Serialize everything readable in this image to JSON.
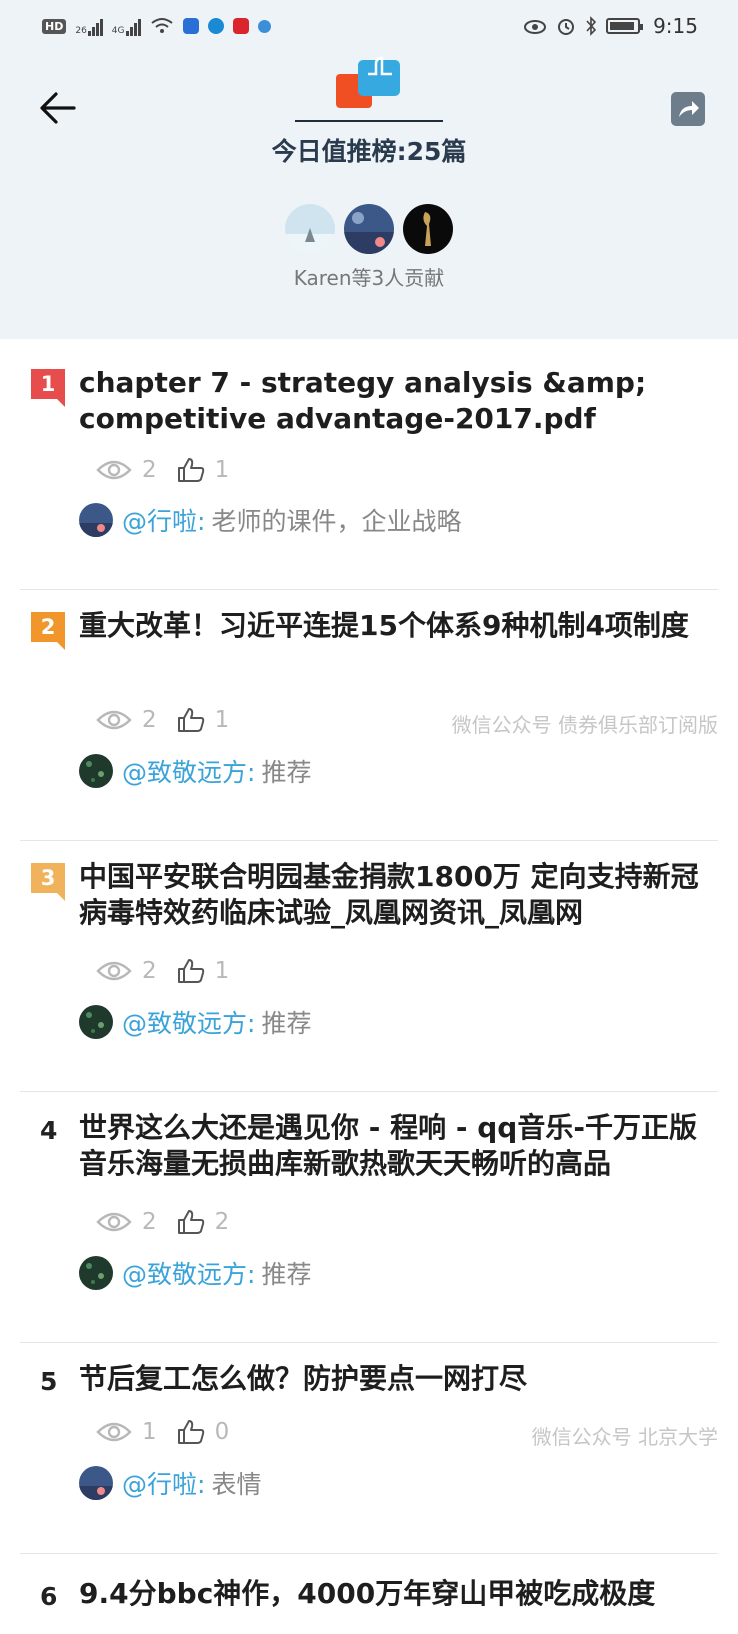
{
  "status_bar": {
    "hd_label": "HD",
    "hd_sub": "2",
    "net1": "26",
    "net2": "4G",
    "time": "9:15"
  },
  "header": {
    "title": "今日值推榜:25篇",
    "contributors_text": "Karen等3人贡献"
  },
  "colors": {
    "rank1": "#e84d4d",
    "rank2": "#f0962b",
    "rank3": "#f0b25a",
    "link": "#3aa3d9",
    "header_bg": "#eef3f8"
  },
  "items": [
    {
      "rank": "1",
      "title": "chapter 7 - strategy analysis &amp; competitive advantage-2017.pdf",
      "views": "2",
      "likes": "1",
      "source": "",
      "author": "@行啦:",
      "note": "老师的课件，企业战略"
    },
    {
      "rank": "2",
      "title": "重大改革！习近平连提15个体系9种机制4项制度",
      "views": "2",
      "likes": "1",
      "source": "微信公众号 债券俱乐部订阅版",
      "author": "@致敬远方:",
      "note": "推荐"
    },
    {
      "rank": "3",
      "title": "中国平安联合明园基金捐款1800万 定向支持新冠病毒特效药临床试验_凤凰网资讯_凤凰网",
      "views": "2",
      "likes": "1",
      "source": "",
      "author": "@致敬远方:",
      "note": "推荐"
    },
    {
      "rank": "4",
      "title": "世界这么大还是遇见你 - 程响 - qq音乐-千万正版音乐海量无损曲库新歌热歌天天畅听的高品",
      "views": "2",
      "likes": "2",
      "source": "",
      "author": "@致敬远方:",
      "note": "推荐"
    },
    {
      "rank": "5",
      "title": "节后复工怎么做？防护要点一网打尽",
      "views": "1",
      "likes": "0",
      "source": "微信公众号 北京大学",
      "author": "@行啦:",
      "note": "表情"
    },
    {
      "rank": "6",
      "title": "9.4分bbc神作，4000万年穿山甲被吃成极度",
      "views": "",
      "likes": "",
      "source": "",
      "author": "",
      "note": ""
    }
  ]
}
